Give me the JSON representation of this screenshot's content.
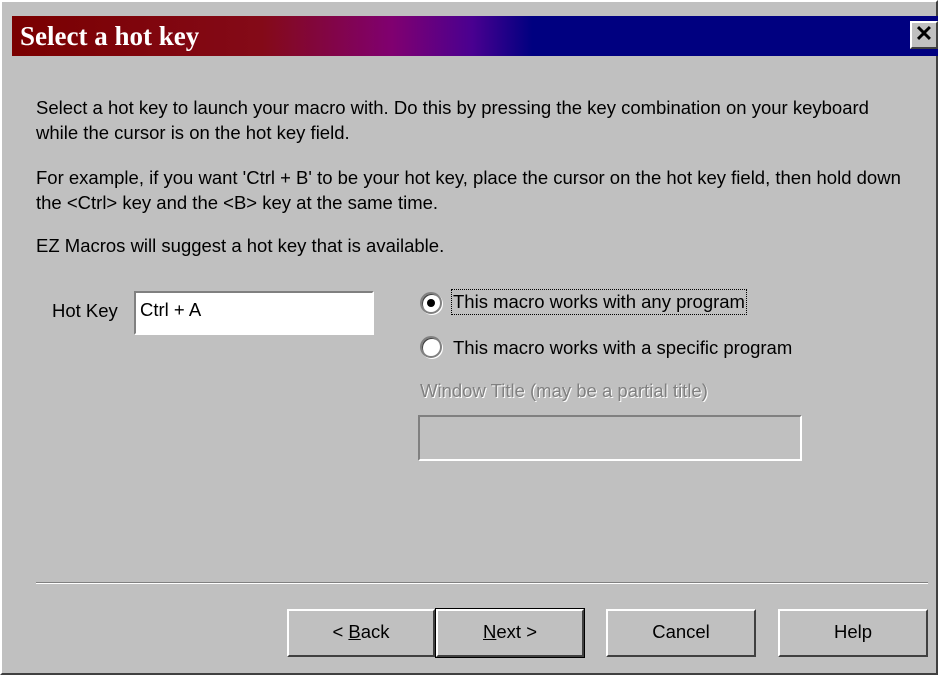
{
  "window": {
    "title": "Select a hot key",
    "close_glyph": "✕"
  },
  "instructions": {
    "line1": "Select a hot key to launch your macro with.  Do this by pressing the key combination on your keyboard while the cursor is on the hot key field.",
    "line2": "For example, if you want 'Ctrl + B' to be your hot key, place the cursor on the hot key field, then hold down the <Ctrl> key and the <B> key at the same time.",
    "line3": "EZ Macros will suggest a hot key that is available."
  },
  "hotkey": {
    "label": "Hot Key",
    "value": "Ctrl + A"
  },
  "scope": {
    "options": [
      {
        "label": "This macro works with any program",
        "selected": true
      },
      {
        "label": "This macro works with a specific program",
        "selected": false
      }
    ],
    "window_title_label": "Window Title (may be a partial title)",
    "window_title_value": ""
  },
  "buttons": {
    "back_prefix": "< ",
    "back_mnemonic": "B",
    "back_rest": "ack",
    "next_mnemonic": "N",
    "next_rest": "ext >",
    "cancel": "Cancel",
    "help": "Help"
  }
}
